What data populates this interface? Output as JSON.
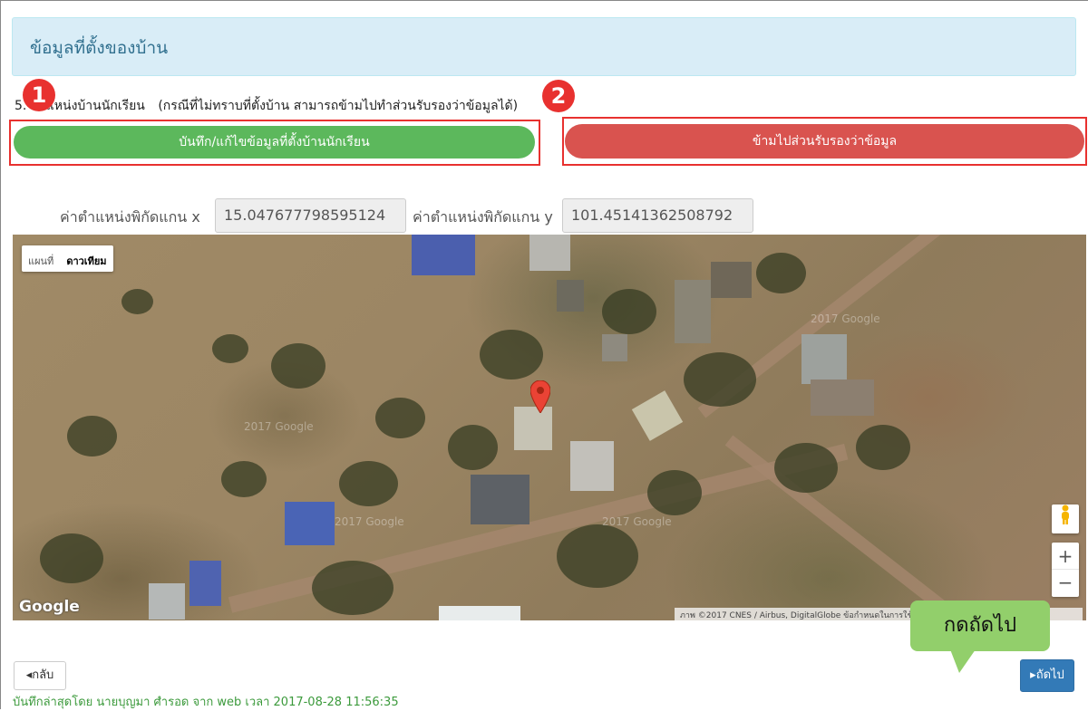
{
  "panel": {
    "title": "ข้อมูลที่ตั้งของบ้าน"
  },
  "section": {
    "label": "5. ตำแหน่งบ้านนักเรียน",
    "note": "(กรณีที่ไม่ทราบที่ตั้งบ้าน  สามารถข้ามไปทำส่วนรับรองว่าข้อมูลได้)"
  },
  "badges": {
    "one": "1",
    "two": "2"
  },
  "buttons": {
    "save_location": "บันทึก/แก้ไขข้อมูลที่ตั้งบ้านนักเรียน",
    "skip": "ข้ามไปส่วนรับรองว่าข้อมูล",
    "back": "◂กลับ",
    "next": "▸ถัดไป"
  },
  "coords": {
    "x_label": "ค่าตำแหน่งพิกัดแกน  x",
    "x_value": "15.047677798595124",
    "y_label": "ค่าตำแหน่งพิกัดแกน  y",
    "y_value": "101.45141362508792"
  },
  "map": {
    "type_map": "แผนที่",
    "type_satellite": "ดาวเทียม",
    "watermark": "2017 Google",
    "logo": "Google",
    "attribution": "ภาพ ©2017 CNES / Airbus, DigitalGlobe    ข้อกำหนดในการใช้งาน",
    "zoom_in": "+",
    "zoom_out": "−"
  },
  "callout": {
    "text": "กดถัดไป"
  },
  "footer": {
    "text": "บันทึกล่าสุดโดย นายบุญมา ศำรอด จาก web เวลา 2017-08-28 11:56:35"
  },
  "colors": {
    "heading_bg": "#d9edf7",
    "green": "#5cb85c",
    "red": "#d9534f",
    "highlight": "#e8312f",
    "primary": "#337ab7",
    "callout": "#92cf6b"
  }
}
